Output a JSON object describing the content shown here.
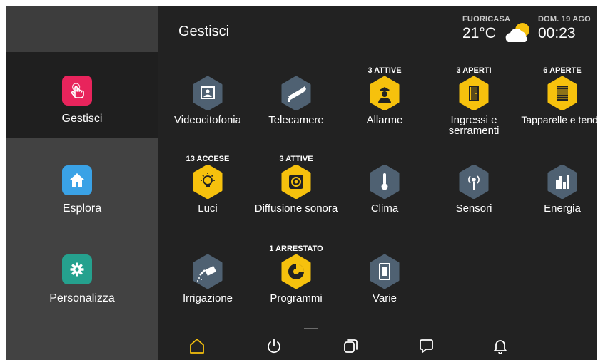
{
  "header": {
    "title": "Gestisci",
    "weather": {
      "location": "FUORICASA",
      "temperature": "21°C",
      "icon": "partly-cloudy-icon"
    },
    "datetime": {
      "date": "DOM. 19 AGO",
      "time": "00:23"
    }
  },
  "sidebar": {
    "items": [
      {
        "label": "Gestisci",
        "icon": "hand-touch-icon",
        "color": "#e8245c",
        "active": true
      },
      {
        "label": "Esplora",
        "icon": "home-icon",
        "color": "#3aa2e6",
        "active": false
      },
      {
        "label": "Personalizza",
        "icon": "gear-icon",
        "color": "#25a18e",
        "active": false
      }
    ]
  },
  "grid": {
    "tiles": [
      {
        "label": "Videocitofonia",
        "badge": "",
        "icon": "videocitofonia-icon"
      },
      {
        "label": "Telecamere",
        "badge": "",
        "icon": "camera-icon"
      },
      {
        "label": "Allarme",
        "badge": "3 ATTIVE",
        "icon": "alarm-guard-icon"
      },
      {
        "label": "Ingressi e serramenti",
        "badge": "3 APERTI",
        "icon": "door-icon"
      },
      {
        "label": "Tapparelle e tende",
        "badge": "6 APERTE",
        "icon": "shutter-icon"
      },
      {
        "label": "Luci",
        "badge": "13 ACCESE",
        "icon": "bulb-icon"
      },
      {
        "label": "Diffusione sonora",
        "badge": "3 ATTIVE",
        "icon": "speaker-icon"
      },
      {
        "label": "Clima",
        "badge": "",
        "icon": "thermometer-icon"
      },
      {
        "label": "Sensori",
        "badge": "",
        "icon": "sensor-icon"
      },
      {
        "label": "Energia",
        "badge": "",
        "icon": "energy-bars-icon"
      },
      {
        "label": "Irrigazione",
        "badge": "",
        "icon": "watering-can-icon"
      },
      {
        "label": "Programmi",
        "badge": "1 ARRESTATO",
        "icon": "program-icon"
      },
      {
        "label": "Varie",
        "badge": "",
        "icon": "switch-icon"
      }
    ]
  },
  "bottom_nav": {
    "items": [
      {
        "icon": "home-outline-icon",
        "active": true
      },
      {
        "icon": "power-icon",
        "active": false
      },
      {
        "icon": "windows-icon",
        "active": false
      },
      {
        "icon": "chat-icon",
        "active": false
      },
      {
        "icon": "bell-icon",
        "active": false
      }
    ]
  },
  "colors": {
    "active_hex": "#f6c10d",
    "inactive_hex": "#4f6172",
    "active_nav": "#f6c10d"
  }
}
